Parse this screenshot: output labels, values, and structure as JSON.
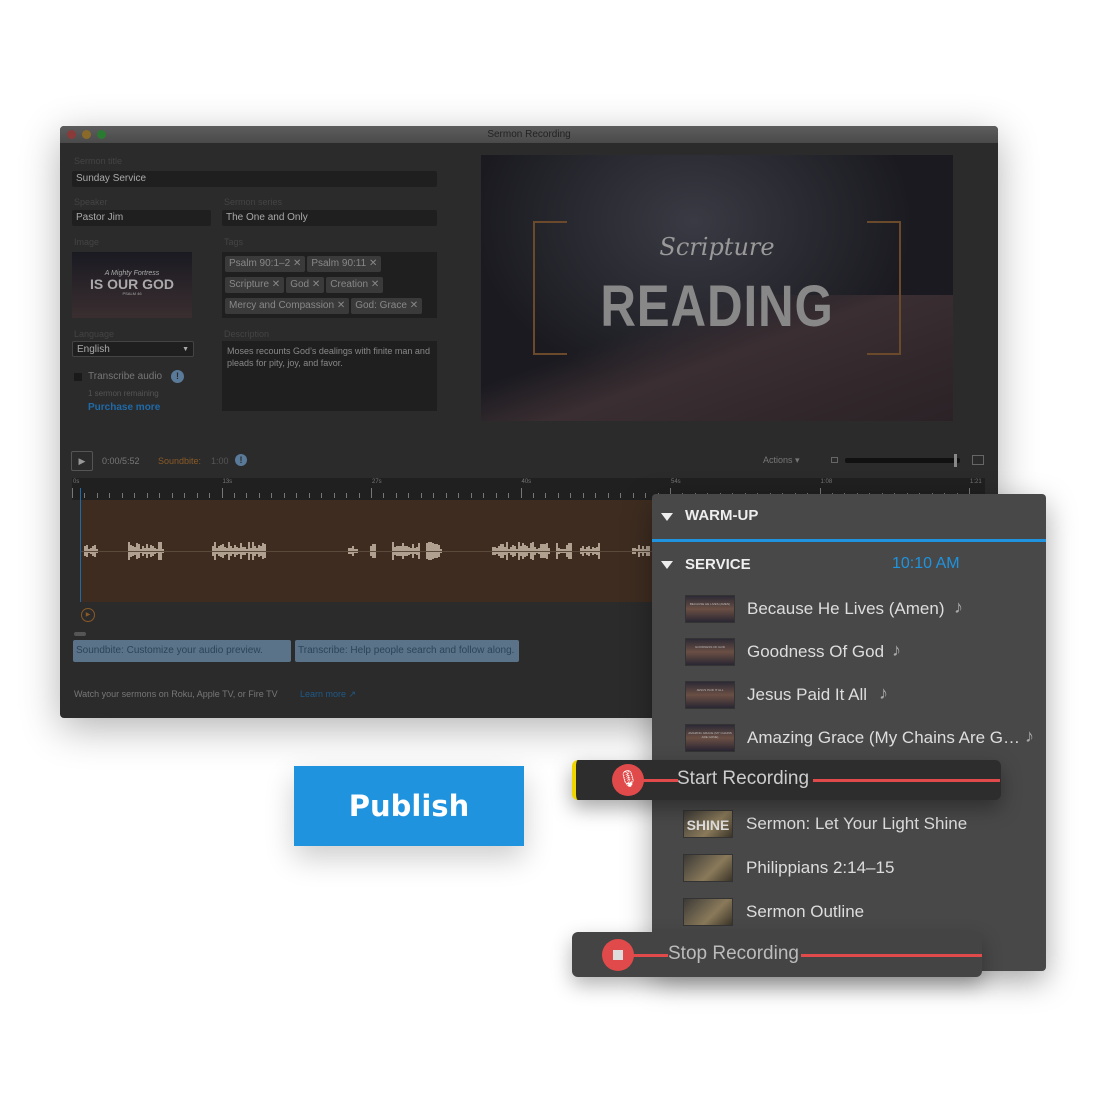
{
  "window": {
    "title": "Sermon Recording"
  },
  "form": {
    "sermon_title_label": "Sermon title",
    "sermon_title": "Sunday Service",
    "speaker_label": "Speaker",
    "speaker": "Pastor Jim",
    "series_label": "Sermon series",
    "series": "The One and Only",
    "image_label": "Image",
    "image_text": {
      "line1": "A Mighty Fortress",
      "line2": "IS OUR GOD",
      "line3": "PSALM 46"
    },
    "tags_label": "Tags",
    "tags": [
      "Psalm 90:1–2",
      "Psalm 90:11",
      "Scripture",
      "God",
      "Creation",
      "Mercy and Compassion",
      "God: Grace"
    ],
    "language_label": "Language",
    "language": "English",
    "transcribe_label": "Transcribe audio",
    "remaining": "1 sermon remaining",
    "purchase": "Purchase more",
    "description_label": "Description",
    "description": "Moses recounts God’s dealings with finite man and pleads for pity, joy, and favor."
  },
  "preview": {
    "script": "Scripture",
    "title": "READING"
  },
  "player": {
    "time": "0:00/5:52",
    "soundbite_label": "Soundbite:",
    "soundbite_value": "1:00",
    "actions": "Actions ▾",
    "zoom_level": 0.97
  },
  "timeline": {
    "ticks": [
      "0s",
      "13s",
      "27s",
      "40s",
      "54s",
      "1:08",
      "1:21"
    ]
  },
  "chips": [
    "Soundbite: Customize your audio preview.",
    "Transcribe: Help people search and follow along."
  ],
  "footer": {
    "text": "Watch your sermons on Roku, Apple TV, or Fire TV",
    "link": "Learn more"
  },
  "publish": "Publish",
  "panel": {
    "warmup": "WARM-UP",
    "service": "SERVICE",
    "service_time": "10:10 AM",
    "songs": [
      {
        "title": "Because He Lives (Amen)",
        "thumb": "BECAUSE HE LIVES (AMEN)"
      },
      {
        "title": "Goodness Of God",
        "thumb": "GOODNESS OF GOD"
      },
      {
        "title": "Jesus Paid It All",
        "thumb": "JESUS PAID IT ALL"
      },
      {
        "title": "Amazing Grace (My Chains Are G…",
        "thumb": "AMAZING GRACE (MY CHAINS ARE GONE)"
      }
    ],
    "start_recording": "Start Recording",
    "sermon_items": [
      {
        "title": "Sermon: Let Your Light Shine",
        "thumb": "SHINE"
      },
      {
        "title": "Philippians 2:14–15"
      },
      {
        "title": "Sermon Outline"
      }
    ],
    "stop_recording": "Stop Recording"
  },
  "colors": {
    "accent": "#1f93de",
    "record": "#e04a4a",
    "soundbite": "#b8742e",
    "highlight": "#f0d600"
  }
}
